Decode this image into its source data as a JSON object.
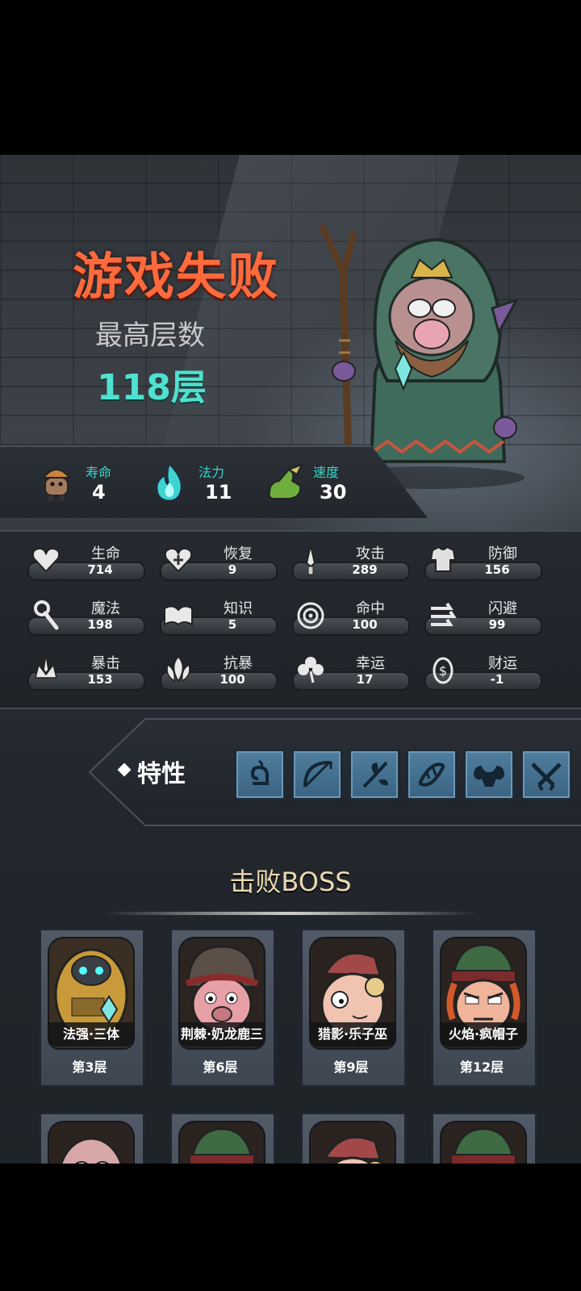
{
  "result": {
    "title": "游戏失败",
    "best_floor_label": "最高层数",
    "best_floor_value": "118层"
  },
  "top_stats": [
    {
      "label": "寿命",
      "value": "4",
      "icon": "lifespan-icon"
    },
    {
      "label": "法力",
      "value": "11",
      "icon": "mana-flame-icon"
    },
    {
      "label": "速度",
      "value": "30",
      "icon": "speed-boot-icon"
    }
  ],
  "stats": [
    {
      "label": "生命",
      "value": "714",
      "icon": "heart-icon"
    },
    {
      "label": "恢复",
      "value": "9",
      "icon": "heal-heart-icon"
    },
    {
      "label": "攻击",
      "value": "289",
      "icon": "sword-icon"
    },
    {
      "label": "防御",
      "value": "156",
      "icon": "armor-icon"
    },
    {
      "label": "魔法",
      "value": "198",
      "icon": "staff-icon"
    },
    {
      "label": "知识",
      "value": "5",
      "icon": "book-icon"
    },
    {
      "label": "命中",
      "value": "100",
      "icon": "target-icon"
    },
    {
      "label": "闪避",
      "value": "99",
      "icon": "dodge-icon"
    },
    {
      "label": "暴击",
      "value": "153",
      "icon": "crit-icon"
    },
    {
      "label": "抗暴",
      "value": "100",
      "icon": "crit-resist-icon"
    },
    {
      "label": "幸运",
      "value": "17",
      "icon": "clover-icon"
    },
    {
      "label": "财运",
      "value": "-1",
      "icon": "coin-icon"
    }
  ],
  "traits": {
    "label": "特性",
    "items": [
      "swirl-trait-icon",
      "bow-trait-icon",
      "plant-trait-icon",
      "dna-trait-icon",
      "muscle-trait-icon",
      "crossed-guns-trait-icon"
    ]
  },
  "boss_section": {
    "title": "击败BOSS",
    "bosses": [
      {
        "name": "法强·三体",
        "floor": "第3层"
      },
      {
        "name": "荆棘·奶龙鹿三",
        "floor": "第6层"
      },
      {
        "name": "猎影·乐子巫",
        "floor": "第9层"
      },
      {
        "name": "火焰·疯帽子",
        "floor": "第12层"
      }
    ]
  },
  "colors": {
    "title": "#ff6a3d",
    "best_value": "#4fe1d0",
    "top_stat_label": "#36d6c8",
    "trait_tile": "#4f7e9e"
  }
}
